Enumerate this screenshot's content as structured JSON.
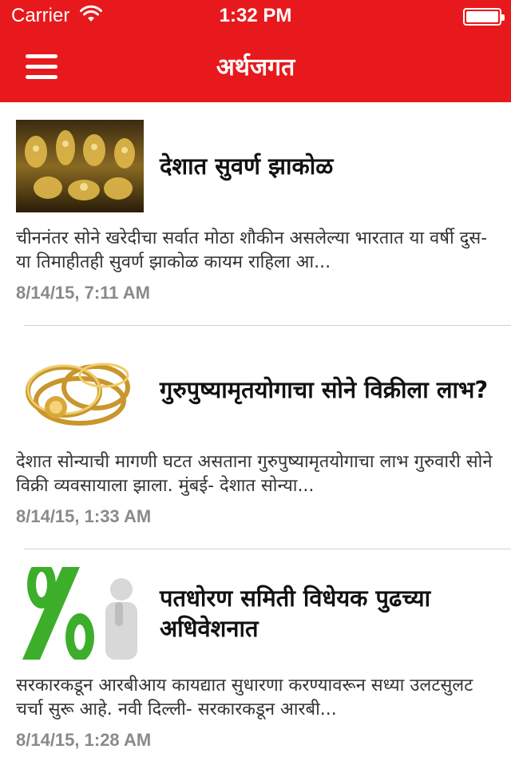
{
  "status": {
    "carrier": "Carrier",
    "time": "1:32 PM"
  },
  "nav": {
    "title": "अर्थजगत",
    "menu_icon": "hamburger-menu-icon"
  },
  "articles": [
    {
      "title": "देशात सुवर्ण झाकोळ",
      "summary": "चीननंतर सोने खरेदीचा सर्वात मोठा शौकीन असलेल्या भारतात या वर्षी दुस-या तिमाहीतही सुवर्ण झाकोळ कायम राहिला आ...",
      "date": "8/14/15, 7:11 AM",
      "thumb": "gold-jewellery-shop-image"
    },
    {
      "title": "गुरुपुष्यामृतयोगाचा सोने विक्रीला लाभ?",
      "summary": "देशात सोन्याची मागणी घटत असताना गुरुपुष्यामृतयोगाचा लाभ गुरुवारी सोने विक्री व्यवसायाला झाला. मुंबई- देशात सोन्या...",
      "date": "8/14/15, 1:33 AM",
      "thumb": "gold-chains-image"
    },
    {
      "title": "पतधोरण समिती विधेयक पुढच्या अधिवेशनात",
      "summary": "सरकारकडून आरबीआय कायद्यात सुधारणा करण्यावरून सध्या उलटसुलट चर्चा सुरू आहे. नवी दिल्ली- सरकारकडून आरबी...",
      "date": "8/14/15, 1:28 AM",
      "thumb": "percent-sign-thinking-man-image"
    }
  ]
}
